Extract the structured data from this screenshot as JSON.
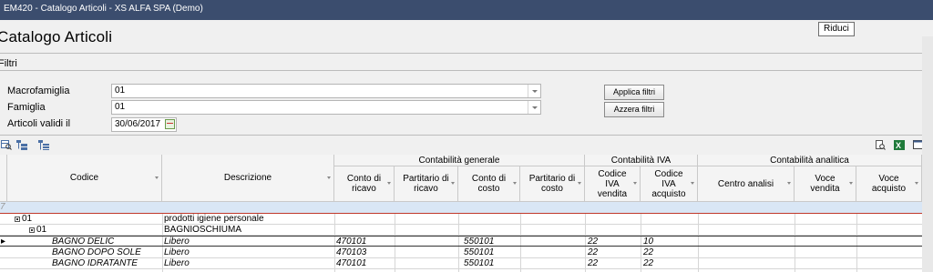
{
  "window": {
    "title": "EM420 - Catalogo Articoli - XS ALFA SPA  (Demo)",
    "tooltip": "Riduci"
  },
  "page": {
    "title": "Catalogo Articoli"
  },
  "filters": {
    "section_label": "Filtri",
    "macrofamiglia": {
      "label": "Macrofamiglia",
      "value": "01"
    },
    "famiglia": {
      "label": "Famiglia",
      "value": "01"
    },
    "validita": {
      "label": "Articoli validi il",
      "value": "30/06/2017"
    },
    "apply_label": "Applica filtri",
    "reset_label": "Azzera filtri"
  },
  "grid": {
    "groups": {
      "generale": "Contabilità generale",
      "iva": "Contabilità IVA",
      "analitica": "Contabilità analitica"
    },
    "columns": {
      "codice": "Codice",
      "descrizione": "Descrizione",
      "conto_ricavo": "Conto di ricavo",
      "partitario_ricavo": "Partitario di ricavo",
      "conto_costo": "Conto di costo",
      "partitario_costo": "Partitario di costo",
      "iva_vendita": "Codice IVA vendita",
      "iva_acquisto": "Codice IVA acquisto",
      "centro_analisi": "Centro analisi",
      "voce_vendita": "Voce vendita",
      "voce_acquisto": "Voce acquisto"
    },
    "filter_row_marker": "7",
    "group_rows": [
      {
        "code": "01",
        "description": "prodotti igiene personale"
      },
      {
        "code": "01",
        "description": "BAGNIOSCHIUMA"
      }
    ],
    "rows": [
      {
        "codice": "BAGNO DELIC",
        "descrizione": "Libero",
        "conto_ricavo": "470101",
        "conto_costo": "550101",
        "iva_vendita": "22",
        "iva_acquisto": "10"
      },
      {
        "codice": "BAGNO DOPO SOLE",
        "descrizione": "Libero",
        "conto_ricavo": "470103",
        "conto_costo": "550101",
        "iva_vendita": "22",
        "iva_acquisto": "22"
      },
      {
        "codice": "BAGNO IDRATANTE",
        "descrizione": "Libero",
        "conto_ricavo": "470101",
        "conto_costo": "550101",
        "iva_vendita": "22",
        "iva_acquisto": "22"
      }
    ]
  },
  "icons": {
    "toolbar_left": [
      "zoom-grid-icon",
      "expand-tree-icon",
      "collapse-tree-icon"
    ],
    "toolbar_right": [
      "print-preview-icon",
      "excel-export-icon",
      "columns-chooser-icon"
    ]
  }
}
